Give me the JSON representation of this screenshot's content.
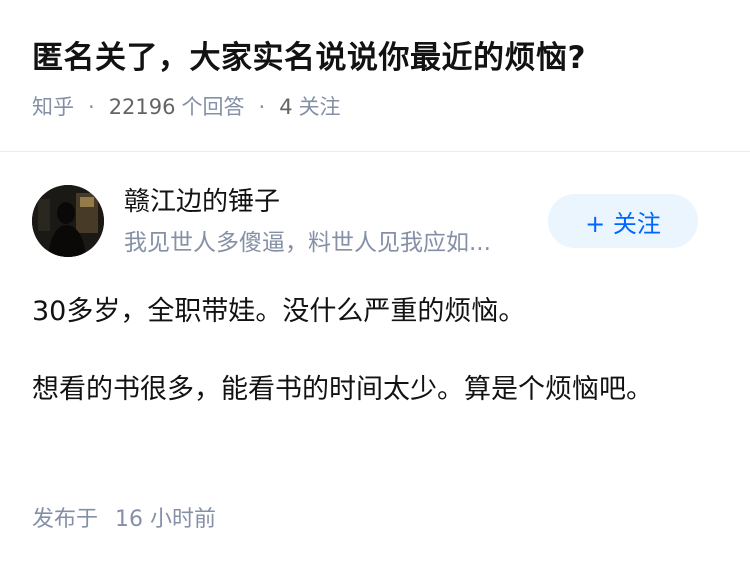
{
  "question": {
    "title": "匿名关了，大家实名说说你最近的烦恼?",
    "source": "知乎",
    "answers_count": "22196",
    "answers_label": "个回答",
    "followers_count": "4",
    "followers_label": "关注"
  },
  "author": {
    "name": "赣江边的锤子",
    "bio": "我见世人多傻逼，料世人见我应如...",
    "avatar_icon": "avatar-photo",
    "follow_label": "+ 关注"
  },
  "answer": {
    "paragraphs": [
      "30多岁，全职带娃。没什么严重的烦恼。",
      "想看的书很多，能看书的时间太少。算是个烦恼吧。"
    ],
    "published_prefix": "发布于",
    "published_value": "16 小时前"
  },
  "colors": {
    "accent": "#0066ff",
    "follow_bg": "#ebf5fd",
    "muted": "#8590a6"
  }
}
